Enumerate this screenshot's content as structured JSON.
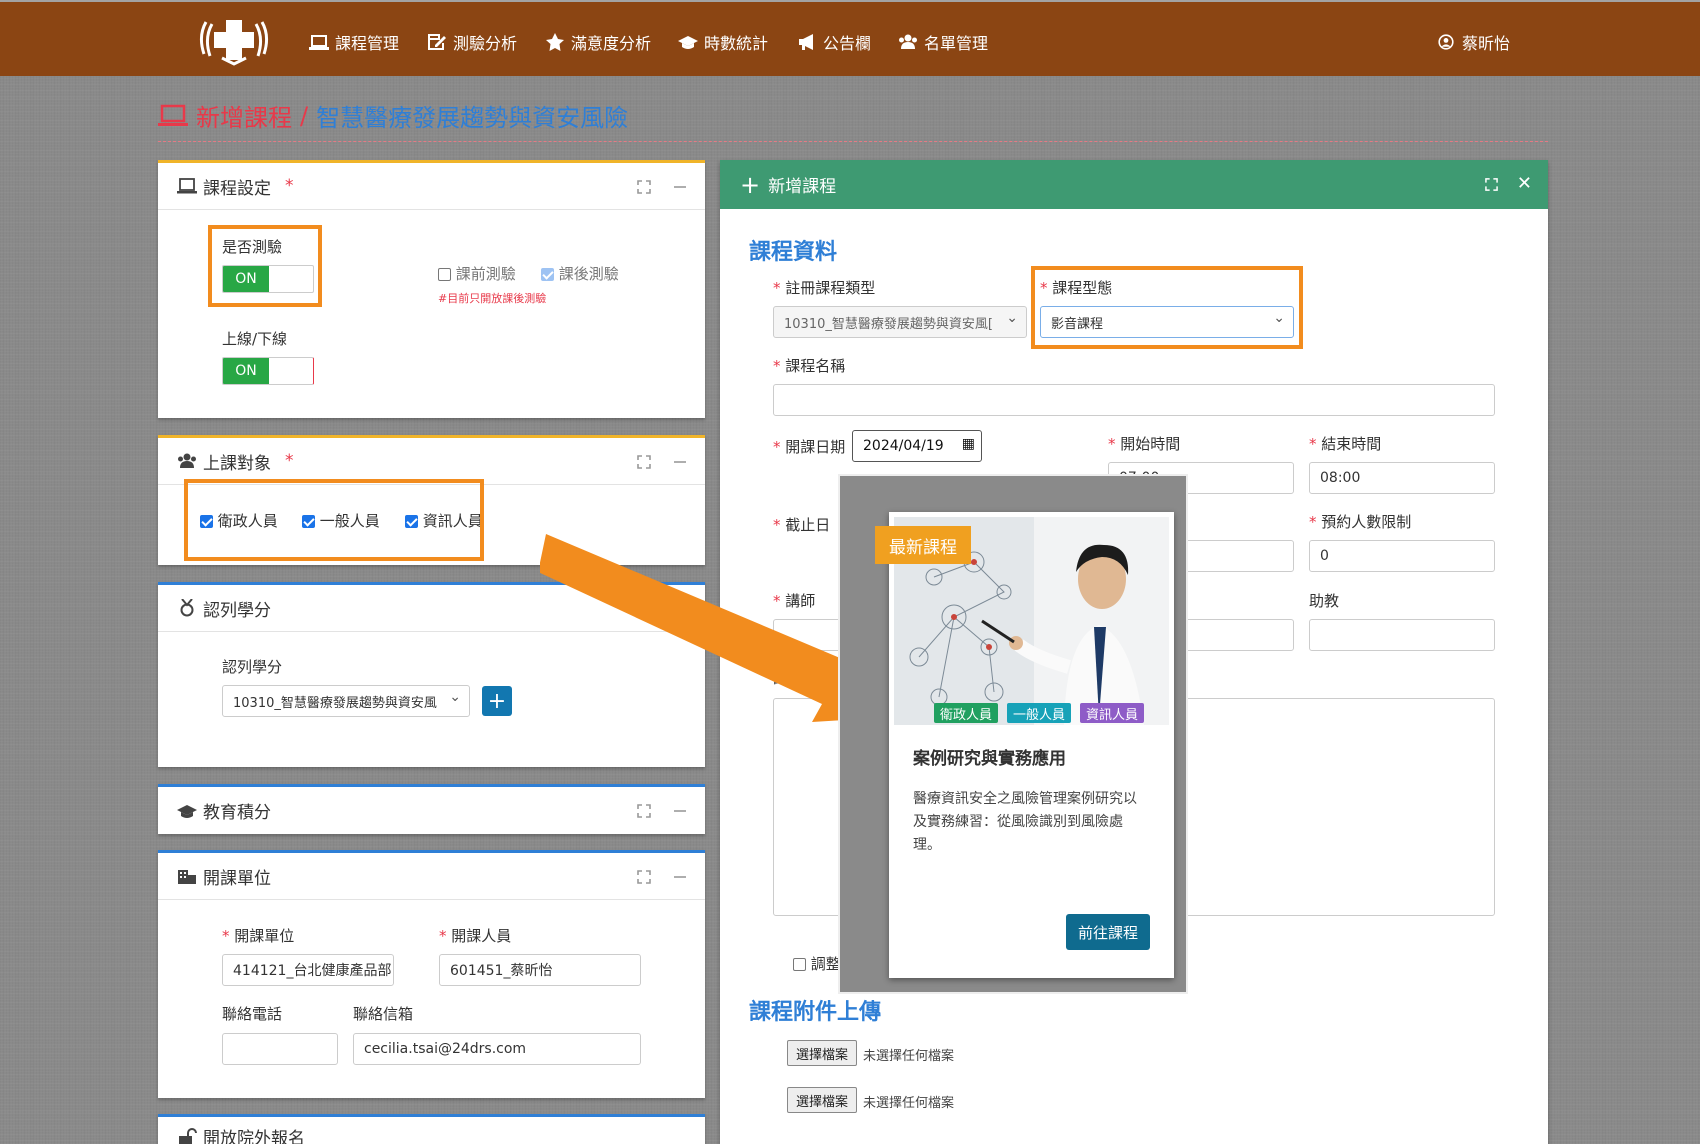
{
  "navbar": {
    "items": [
      "課程管理",
      "測驗分析",
      "滿意度分析",
      "時數統計",
      "公告欄",
      "名單管理"
    ],
    "user": "蔡昕怡"
  },
  "page": {
    "title_prefix": "新增課程",
    "separator": "/",
    "title_course": "智慧醫療發展趨勢與資安風險"
  },
  "settings_panel": {
    "title": "課程設定",
    "quiz_label": "是否測驗",
    "quiz_toggle": "ON",
    "online_label": "上線/下線",
    "online_toggle": "ON",
    "pre_test": "課前測驗",
    "post_test": "課後測驗",
    "note": "#目前只開放課後測驗"
  },
  "audience_panel": {
    "title": "上課對象",
    "options": [
      "衛政人員",
      "一般人員",
      "資訊人員"
    ]
  },
  "credit_panel": {
    "title": "認列學分",
    "label": "認列學分",
    "select_value": "10310_智慧醫療發展趨勢與資安風",
    "add_button": "+"
  },
  "edu_panel": {
    "title": "教育積分"
  },
  "unit_panel": {
    "title": "開課單位",
    "unit_label": "開課單位",
    "unit_value": "414121_台北健康產品部",
    "staff_label": "開課人員",
    "staff_value": "601451_蔡昕怡",
    "phone_label": "聯絡電話",
    "phone_value": "",
    "email_label": "聯絡信箱",
    "email_value": "cecilia.tsai@24drs.com"
  },
  "external_panel": {
    "title": "開放院外報名"
  },
  "form": {
    "header": "新增課程",
    "section_info": "課程資料",
    "type_label": "註冊課程類型",
    "type_value": "10310_智慧醫療發展趨勢與資安風[",
    "format_label": "課程型態",
    "format_value": "影音課程",
    "name_label": "課程名稱",
    "name_value": "",
    "date_label": "開課日期",
    "date_value": "2024/04/19",
    "start_label": "開始時間",
    "start_value": "07:00",
    "end_label": "結束時間",
    "end_value": "08:00",
    "deadline_label": "截止日",
    "limit_label": "預約人數限制",
    "limit_value": "0",
    "teacher_label": "講師",
    "assistant_label": "助教",
    "desc_label": "課程",
    "adjust_label": "調整",
    "section_upload": "課程附件上傳",
    "file_button": "選擇檔案",
    "no_file": "未選擇任何檔案"
  },
  "preview_card": {
    "ribbon": "最新課程",
    "tags": [
      "衛政人員",
      "一般人員",
      "資訊人員"
    ],
    "title": "案例研究與實務應用",
    "desc": "醫療資訊安全之風險管理案例研究以及實務練習：從風險識別到風險處理。",
    "button": "前往課程"
  },
  "colors": {
    "navbar": "#8b4513",
    "accent_red": "#e8394a",
    "accent_blue": "#2f7fd6",
    "green_header": "#3e9a72",
    "highlight": "#f28c1e",
    "toggle_on": "#28a745",
    "tag_green": "#20a060",
    "tag_teal": "#17a2b8",
    "tag_purple": "#8e5cc7",
    "card_button": "#0f6b8f"
  }
}
